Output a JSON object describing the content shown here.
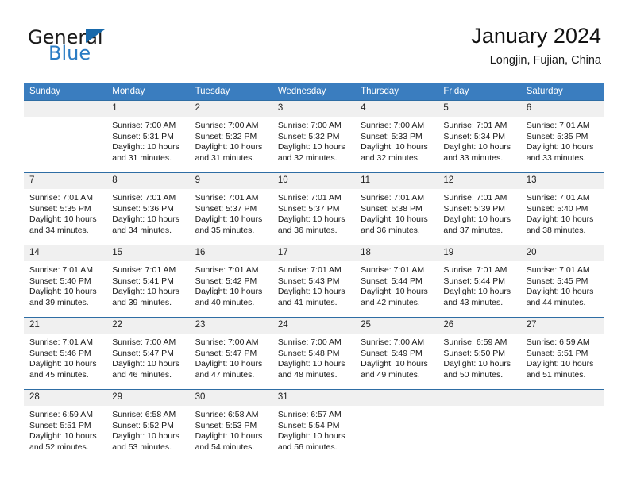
{
  "brand": {
    "name_part1": "General",
    "name_part2": "Blue",
    "triangle_color": "#1769ab",
    "blue_color": "#2b7cc4"
  },
  "header": {
    "title": "January 2024",
    "location": "Longjin, Fujian, China"
  },
  "theme": {
    "header_bg": "#3a7dbf",
    "daynum_bg": "#f0f0f0",
    "row_divider": "#2e6da4"
  },
  "weekday_headers": [
    "Sunday",
    "Monday",
    "Tuesday",
    "Wednesday",
    "Thursday",
    "Friday",
    "Saturday"
  ],
  "weeks": [
    [
      {
        "day": "",
        "lines": []
      },
      {
        "day": "1",
        "lines": [
          "Sunrise: 7:00 AM",
          "Sunset: 5:31 PM",
          "Daylight: 10 hours",
          "and 31 minutes."
        ]
      },
      {
        "day": "2",
        "lines": [
          "Sunrise: 7:00 AM",
          "Sunset: 5:32 PM",
          "Daylight: 10 hours",
          "and 31 minutes."
        ]
      },
      {
        "day": "3",
        "lines": [
          "Sunrise: 7:00 AM",
          "Sunset: 5:32 PM",
          "Daylight: 10 hours",
          "and 32 minutes."
        ]
      },
      {
        "day": "4",
        "lines": [
          "Sunrise: 7:00 AM",
          "Sunset: 5:33 PM",
          "Daylight: 10 hours",
          "and 32 minutes."
        ]
      },
      {
        "day": "5",
        "lines": [
          "Sunrise: 7:01 AM",
          "Sunset: 5:34 PM",
          "Daylight: 10 hours",
          "and 33 minutes."
        ]
      },
      {
        "day": "6",
        "lines": [
          "Sunrise: 7:01 AM",
          "Sunset: 5:35 PM",
          "Daylight: 10 hours",
          "and 33 minutes."
        ]
      }
    ],
    [
      {
        "day": "7",
        "lines": [
          "Sunrise: 7:01 AM",
          "Sunset: 5:35 PM",
          "Daylight: 10 hours",
          "and 34 minutes."
        ]
      },
      {
        "day": "8",
        "lines": [
          "Sunrise: 7:01 AM",
          "Sunset: 5:36 PM",
          "Daylight: 10 hours",
          "and 34 minutes."
        ]
      },
      {
        "day": "9",
        "lines": [
          "Sunrise: 7:01 AM",
          "Sunset: 5:37 PM",
          "Daylight: 10 hours",
          "and 35 minutes."
        ]
      },
      {
        "day": "10",
        "lines": [
          "Sunrise: 7:01 AM",
          "Sunset: 5:37 PM",
          "Daylight: 10 hours",
          "and 36 minutes."
        ]
      },
      {
        "day": "11",
        "lines": [
          "Sunrise: 7:01 AM",
          "Sunset: 5:38 PM",
          "Daylight: 10 hours",
          "and 36 minutes."
        ]
      },
      {
        "day": "12",
        "lines": [
          "Sunrise: 7:01 AM",
          "Sunset: 5:39 PM",
          "Daylight: 10 hours",
          "and 37 minutes."
        ]
      },
      {
        "day": "13",
        "lines": [
          "Sunrise: 7:01 AM",
          "Sunset: 5:40 PM",
          "Daylight: 10 hours",
          "and 38 minutes."
        ]
      }
    ],
    [
      {
        "day": "14",
        "lines": [
          "Sunrise: 7:01 AM",
          "Sunset: 5:40 PM",
          "Daylight: 10 hours",
          "and 39 minutes."
        ]
      },
      {
        "day": "15",
        "lines": [
          "Sunrise: 7:01 AM",
          "Sunset: 5:41 PM",
          "Daylight: 10 hours",
          "and 39 minutes."
        ]
      },
      {
        "day": "16",
        "lines": [
          "Sunrise: 7:01 AM",
          "Sunset: 5:42 PM",
          "Daylight: 10 hours",
          "and 40 minutes."
        ]
      },
      {
        "day": "17",
        "lines": [
          "Sunrise: 7:01 AM",
          "Sunset: 5:43 PM",
          "Daylight: 10 hours",
          "and 41 minutes."
        ]
      },
      {
        "day": "18",
        "lines": [
          "Sunrise: 7:01 AM",
          "Sunset: 5:44 PM",
          "Daylight: 10 hours",
          "and 42 minutes."
        ]
      },
      {
        "day": "19",
        "lines": [
          "Sunrise: 7:01 AM",
          "Sunset: 5:44 PM",
          "Daylight: 10 hours",
          "and 43 minutes."
        ]
      },
      {
        "day": "20",
        "lines": [
          "Sunrise: 7:01 AM",
          "Sunset: 5:45 PM",
          "Daylight: 10 hours",
          "and 44 minutes."
        ]
      }
    ],
    [
      {
        "day": "21",
        "lines": [
          "Sunrise: 7:01 AM",
          "Sunset: 5:46 PM",
          "Daylight: 10 hours",
          "and 45 minutes."
        ]
      },
      {
        "day": "22",
        "lines": [
          "Sunrise: 7:00 AM",
          "Sunset: 5:47 PM",
          "Daylight: 10 hours",
          "and 46 minutes."
        ]
      },
      {
        "day": "23",
        "lines": [
          "Sunrise: 7:00 AM",
          "Sunset: 5:47 PM",
          "Daylight: 10 hours",
          "and 47 minutes."
        ]
      },
      {
        "day": "24",
        "lines": [
          "Sunrise: 7:00 AM",
          "Sunset: 5:48 PM",
          "Daylight: 10 hours",
          "and 48 minutes."
        ]
      },
      {
        "day": "25",
        "lines": [
          "Sunrise: 7:00 AM",
          "Sunset: 5:49 PM",
          "Daylight: 10 hours",
          "and 49 minutes."
        ]
      },
      {
        "day": "26",
        "lines": [
          "Sunrise: 6:59 AM",
          "Sunset: 5:50 PM",
          "Daylight: 10 hours",
          "and 50 minutes."
        ]
      },
      {
        "day": "27",
        "lines": [
          "Sunrise: 6:59 AM",
          "Sunset: 5:51 PM",
          "Daylight: 10 hours",
          "and 51 minutes."
        ]
      }
    ],
    [
      {
        "day": "28",
        "lines": [
          "Sunrise: 6:59 AM",
          "Sunset: 5:51 PM",
          "Daylight: 10 hours",
          "and 52 minutes."
        ]
      },
      {
        "day": "29",
        "lines": [
          "Sunrise: 6:58 AM",
          "Sunset: 5:52 PM",
          "Daylight: 10 hours",
          "and 53 minutes."
        ]
      },
      {
        "day": "30",
        "lines": [
          "Sunrise: 6:58 AM",
          "Sunset: 5:53 PM",
          "Daylight: 10 hours",
          "and 54 minutes."
        ]
      },
      {
        "day": "31",
        "lines": [
          "Sunrise: 6:57 AM",
          "Sunset: 5:54 PM",
          "Daylight: 10 hours",
          "and 56 minutes."
        ]
      },
      {
        "day": "",
        "lines": []
      },
      {
        "day": "",
        "lines": []
      },
      {
        "day": "",
        "lines": []
      }
    ]
  ]
}
